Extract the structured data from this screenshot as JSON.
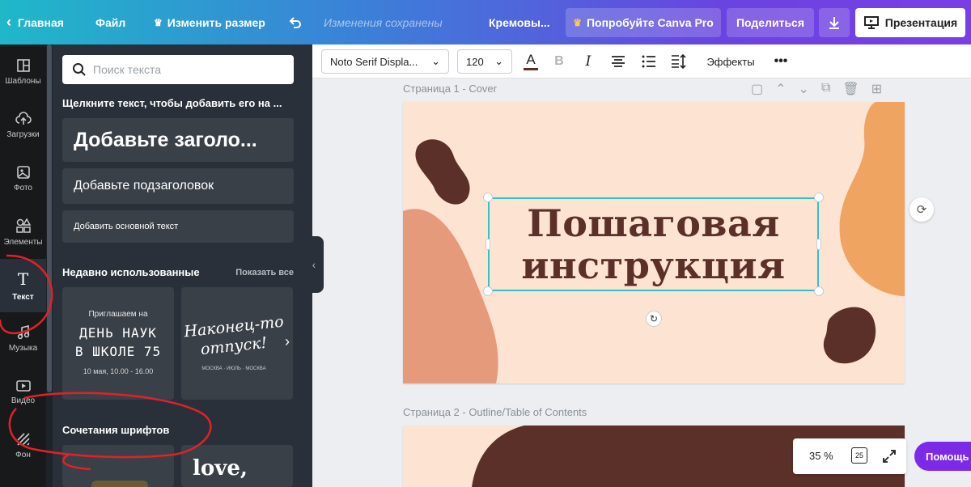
{
  "topbar": {
    "home": "Главная",
    "file": "Файл",
    "resize": "Изменить размер",
    "saved_status": "Изменения сохранены",
    "doc_title": "Кремовы...",
    "try_pro": "Попробуйте Canva Pro",
    "share": "Поделиться",
    "present": "Презентация"
  },
  "rail": {
    "templates": "Шаблоны",
    "uploads": "Загрузки",
    "photos": "Фото",
    "elements": "Элементы",
    "text": "Текст",
    "music": "Музыка",
    "video": "Видео",
    "background": "Фон"
  },
  "panel": {
    "search_placeholder": "Поиск текста",
    "hint": "Щелкните текст, чтобы добавить его на ...",
    "add_heading": "Добавьте заголо...",
    "add_subheading": "Добавьте подзаголовок",
    "add_body": "Добавить основной текст",
    "recent_title": "Недавно использованные",
    "show_all": "Показать все",
    "recent": [
      {
        "line1": "Приглашаем на",
        "line2": "ДЕНЬ НАУК",
        "line3": "В ШКОЛЕ 75",
        "line4": "10 мая, 10.00 - 16.00"
      },
      {
        "line1": "Наконец-то",
        "line2": "отпуск!",
        "line3": "МОСКВА · ИЮЛЬ · МОСКВА"
      }
    ],
    "combos_title": "Сочетания шрифтов",
    "combo_sample": "love,"
  },
  "toolbar": {
    "font": "Noto Serif Displa...",
    "size": "120",
    "effects": "Эффекты"
  },
  "canvas": {
    "page1_label": "Страница 1 - Cover",
    "title_line1": "Пошаговая",
    "title_line2": "инструкция",
    "page2_label": "Страница 2 - Outline/Table of Contents"
  },
  "footer": {
    "zoom": "35 %",
    "page_count": "25",
    "help": "Помощь"
  },
  "colors": {
    "page_bg": "#fde3d1",
    "title_text": "#5a3029",
    "selection": "#2fc4c4",
    "accent_orange": "#efa561",
    "accent_salmon": "#e59a7b",
    "accent_brown": "#5a3029",
    "help_purple": "#7d2ae8"
  }
}
